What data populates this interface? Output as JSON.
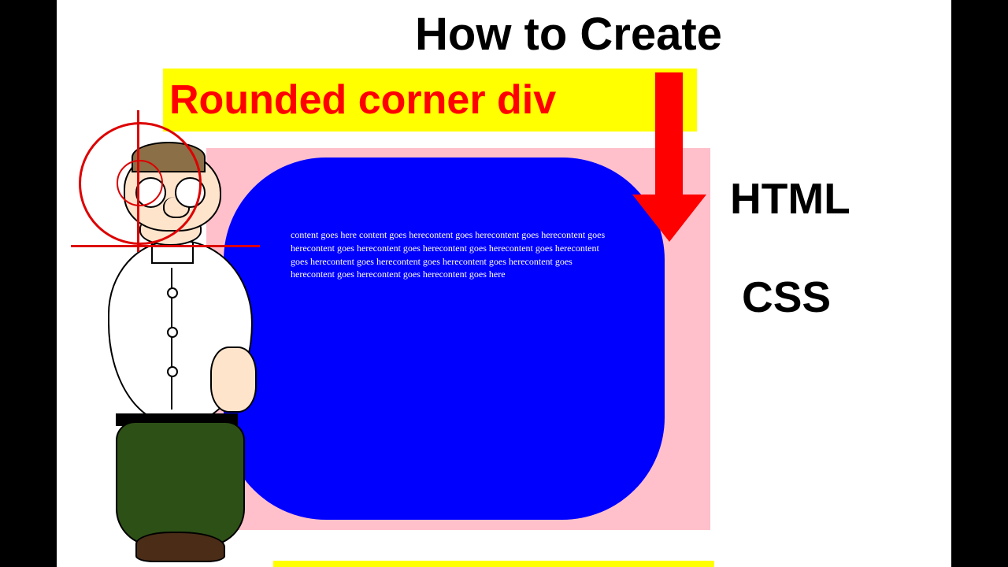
{
  "titles": {
    "main": "How to Create",
    "highlight": "Rounded corner div",
    "html_label": "HTML",
    "css_label": "CSS"
  },
  "demo_box": {
    "content": "content goes here content goes herecontent goes herecontent goes herecontent goes herecontent goes herecontent goes herecontent goes herecontent goes herecontent goes herecontent goes herecontent goes herecontent goes herecontent goes herecontent goes herecontent goes herecontent goes here"
  }
}
